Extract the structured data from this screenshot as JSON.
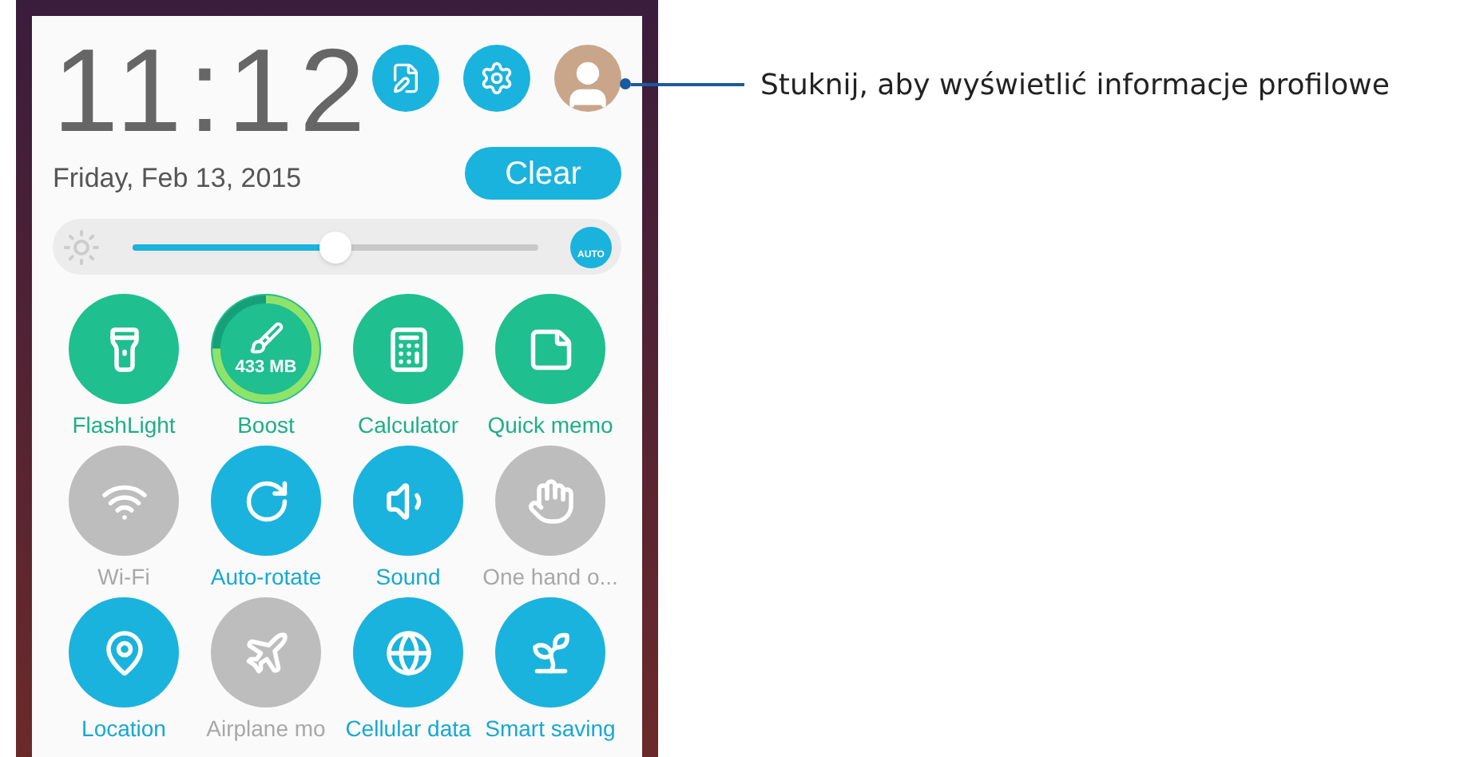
{
  "clock": {
    "time": "11:12",
    "date": "Friday, Feb 13, 2015"
  },
  "clear_button": "Clear",
  "brightness": {
    "level": 0.5,
    "auto_label": "AUTO"
  },
  "tiles": [
    {
      "label": "FlashLight",
      "kind": "app",
      "on": true
    },
    {
      "label": "Boost",
      "kind": "meter",
      "on": true,
      "value": "433 MB",
      "level": 0.75
    },
    {
      "label": "Calculator",
      "kind": "app",
      "on": true
    },
    {
      "label": "Quick memo",
      "kind": "app",
      "on": true
    },
    {
      "label": "Wi-Fi",
      "kind": "toggle",
      "on": false
    },
    {
      "label": "Auto-rotate",
      "kind": "toggle",
      "on": true
    },
    {
      "label": "Sound",
      "kind": "toggle",
      "on": true
    },
    {
      "label": "One hand o...",
      "kind": "toggle",
      "on": false
    },
    {
      "label": "Location",
      "kind": "toggle",
      "on": true
    },
    {
      "label": "Airplane mo",
      "kind": "toggle",
      "on": false
    },
    {
      "label": "Cellular data",
      "kind": "toggle",
      "on": true
    },
    {
      "label": "Smart saving",
      "kind": "toggle",
      "on": true
    }
  ],
  "callout": "Stuknij, aby wyświetlić informacje profilowe"
}
